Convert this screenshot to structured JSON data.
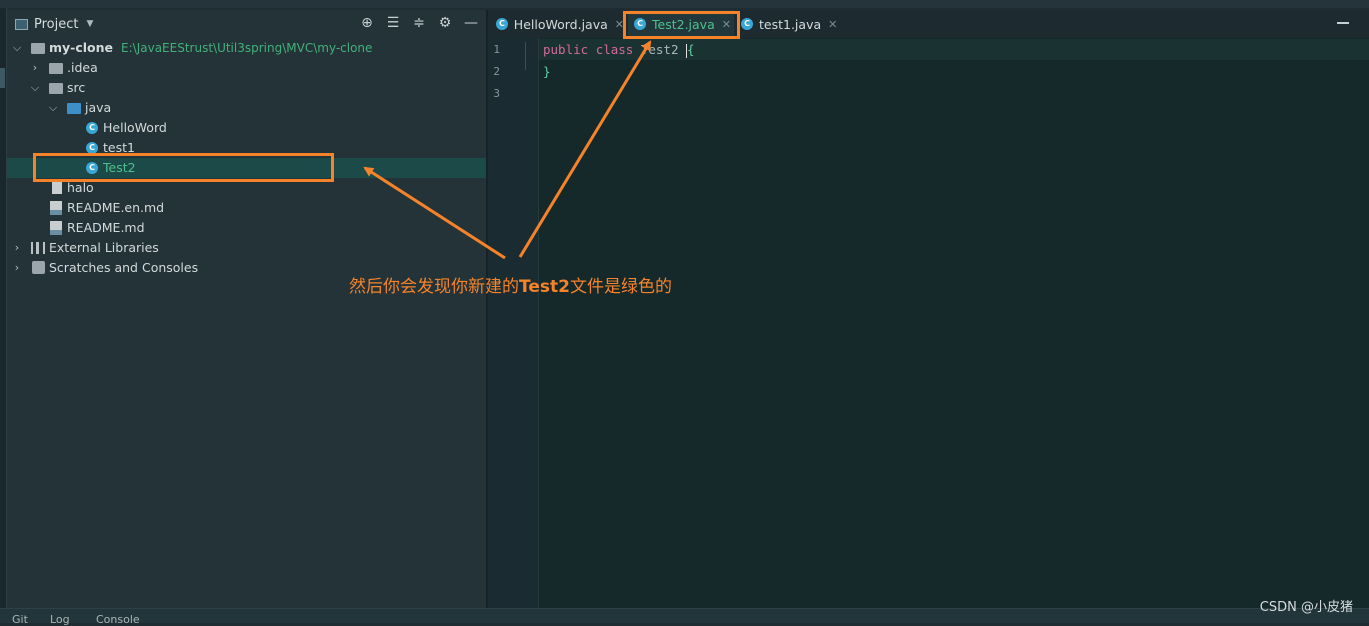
{
  "project_panel": {
    "title": "Project",
    "icons": [
      "target-icon",
      "expand-all-icon",
      "collapse-all-icon",
      "gear-icon",
      "minimize-icon"
    ]
  },
  "tree": [
    {
      "label": "my-clone",
      "path": "E:\\JavaEEStrust\\Util3spring\\MVC\\my-clone",
      "icon": "module-folder-icon"
    },
    {
      "label": ".idea",
      "icon": "folder-icon"
    },
    {
      "label": "src",
      "icon": "folder-icon"
    },
    {
      "label": "java",
      "icon": "source-folder-icon"
    },
    {
      "label": "HelloWord",
      "icon": "java-class-icon"
    },
    {
      "label": "test1",
      "icon": "java-class-icon"
    },
    {
      "label": "Test2",
      "icon": "java-class-icon"
    },
    {
      "label": "halo",
      "icon": "file-icon"
    },
    {
      "label": "README.en.md",
      "icon": "markdown-icon"
    },
    {
      "label": "README.md",
      "icon": "markdown-icon"
    },
    {
      "label": "External Libraries",
      "icon": "libraries-icon"
    },
    {
      "label": "Scratches and Consoles",
      "icon": "scratches-icon"
    }
  ],
  "tabs": [
    {
      "label": "HelloWord.java",
      "closable": true
    },
    {
      "label": "Test2.java",
      "closable": true,
      "active": true
    },
    {
      "label": "test1.java",
      "closable": true
    }
  ],
  "editor": {
    "line_numbers": [
      "1",
      "2",
      "3"
    ],
    "code": {
      "keyword1": "public",
      "keyword2": "class",
      "name": "Test2",
      "open_brace": "{",
      "close_brace": "}"
    }
  },
  "status_tabs": [
    "Git",
    "Log",
    "Console"
  ],
  "annotation": {
    "text_prefix": "然后你会发现你新建的",
    "text_bold": "Test2",
    "text_suffix": "文件是绿色的",
    "color": "#f5832a"
  },
  "watermark": "CSDN @小皮猪",
  "colors": {
    "new_file_green": "#4fc08d",
    "selection": "#1b4a48",
    "keyword": "#cf6a9b"
  }
}
